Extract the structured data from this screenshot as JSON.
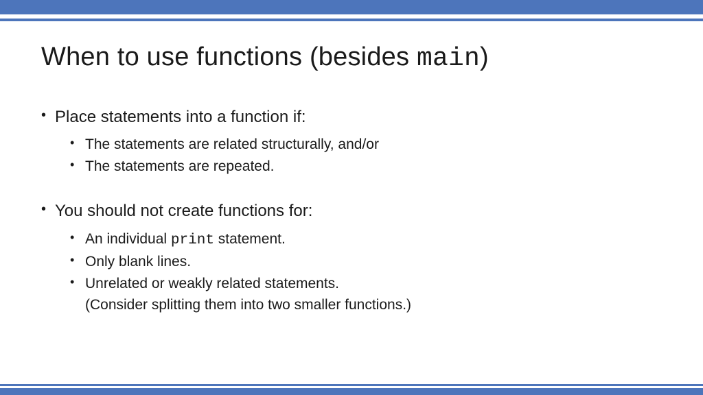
{
  "title": {
    "pre": "When to use functions (besides ",
    "code": "main",
    "post": ")"
  },
  "bullets": [
    {
      "text": "Place statements into a function if:",
      "children": [
        {
          "text": "The statements are related structurally, and/or"
        },
        {
          "text": "The statements are repeated."
        }
      ]
    },
    {
      "text": "You should not create functions for:",
      "children": [
        {
          "pre": "An individual ",
          "code": "print",
          "post": " statement."
        },
        {
          "text": "Only blank lines."
        },
        {
          "text": "Unrelated or weakly related statements.",
          "sub": "(Consider splitting them into two smaller functions.)"
        }
      ]
    }
  ]
}
